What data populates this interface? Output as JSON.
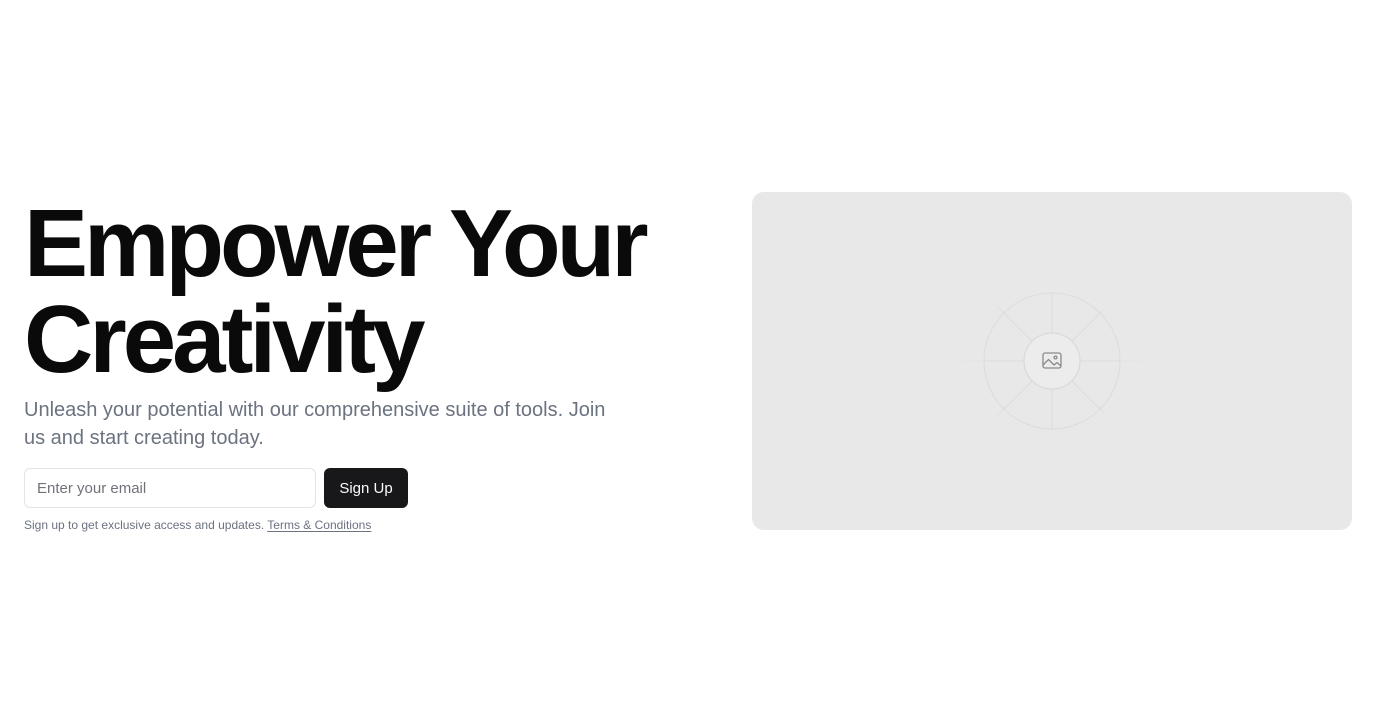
{
  "hero": {
    "headline_line1": "Empower Your",
    "headline_line2": "Creativity",
    "subtitle": "Unleash your potential with our comprehensive suite of tools. Join us and start creating today."
  },
  "signup_form": {
    "email_placeholder": "Enter your email",
    "email_value": "",
    "submit_label": "Sign Up",
    "note_text": "Sign up to get exclusive access and updates.",
    "terms_link_label": "Terms & Conditions"
  },
  "media": {
    "icon": "image-placeholder-icon"
  },
  "colors": {
    "headline": "#0a0a0a",
    "muted_text": "#6b7280",
    "button_bg": "#18181b",
    "button_text": "#fafafa",
    "card_bg": "#e8e8e8"
  }
}
